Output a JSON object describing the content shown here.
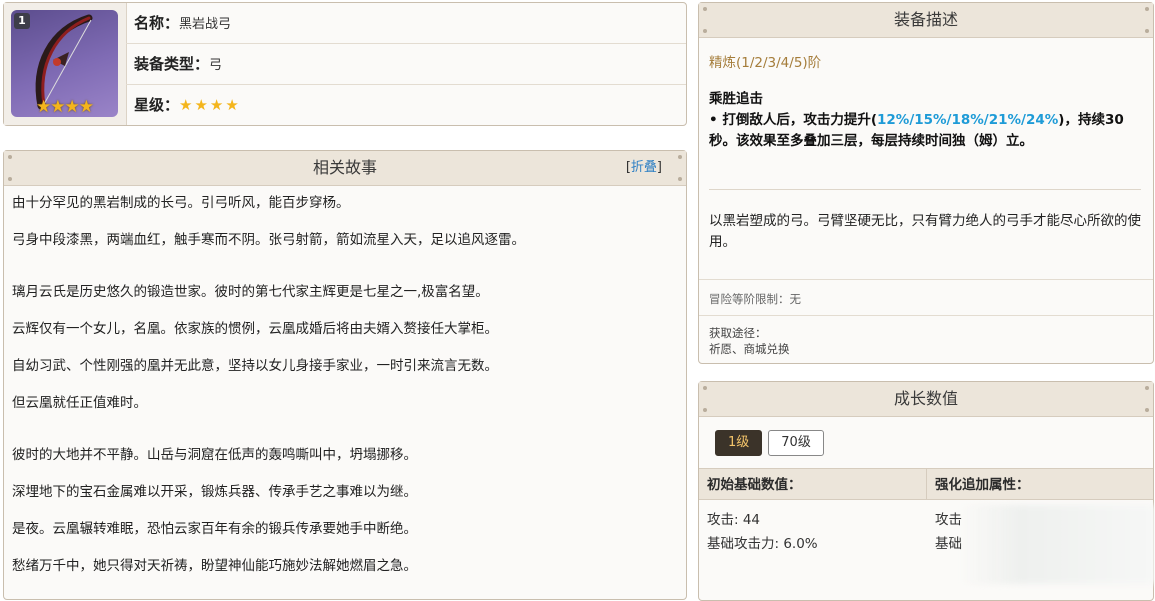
{
  "info": {
    "rarity_badge": "1",
    "icon_stars": "★★★★",
    "name_label": "名称：",
    "name_value": "黑岩战弓",
    "type_label": "装备类型：",
    "type_value": "弓",
    "star_label": "星级：",
    "star_value": "★★★★"
  },
  "story": {
    "title": "相关故事",
    "toggle_open": "[",
    "toggle_link": "折叠",
    "toggle_close": "]",
    "paragraphs": [
      "由十分罕见的黑岩制成的长弓。引弓听风，能百步穿杨。",
      "弓身中段漆黑，两端血红，触手寒而不阴。张弓射箭，箭如流星入天，足以追风逐雷。",
      "璃月云氏是历史悠久的锻造世家。彼时的第七代家主辉更是七星之一,极富名望。",
      "云辉仅有一个女儿，名凰。依家族的惯例，云凰成婚后将由夫婿入赘接任大掌柜。",
      "自幼习武、个性刚强的凰并无此意，坚持以女儿身接手家业，一时引来流言无数。",
      "但云凰就任正值难时。",
      "彼时的大地并不平静。山岳与洞窟在低声的轰鸣嘶叫中，坍塌挪移。",
      "深埋地下的宝石金属难以开采，锻炼兵器、传承手艺之事难以为继。",
      "是夜。云凰辗转难眠，恐怕云家百年有余的锻兵传承要她手中断绝。",
      "愁绪万千中，她只得对天祈祷，盼望神仙能巧施妙法解她燃眉之急。"
    ]
  },
  "desc": {
    "title": "装备描述",
    "refine": "精炼(1/2/3/4/5)阶",
    "skill_name": "乘胜追击",
    "skill_pre": "• 打倒敌人后，攻击力提升(",
    "skill_values": "12%/15%/18%/21%/24%",
    "skill_post": ")，持续30秒。该效果至多叠加三层，每层持续时间独（姆）立。",
    "flavor": "以黑岩塑成的弓。弓臂坚硬无比，只有臂力绝人的弓手才能尽心所欲的使用。",
    "limit": "冒险等阶限制：无",
    "source_label": "获取途径：",
    "source_value": "祈愿、商城兑换"
  },
  "growth": {
    "title": "成长数值",
    "levels": [
      "1级",
      "70级"
    ],
    "col1_head": "初始基础数值：",
    "col2_head": "强化追加属性：",
    "attack": "攻击: 44",
    "base_atk": "基础攻击力: 6.0%",
    "col2_line1": "攻击",
    "col2_line2": "基础"
  }
}
